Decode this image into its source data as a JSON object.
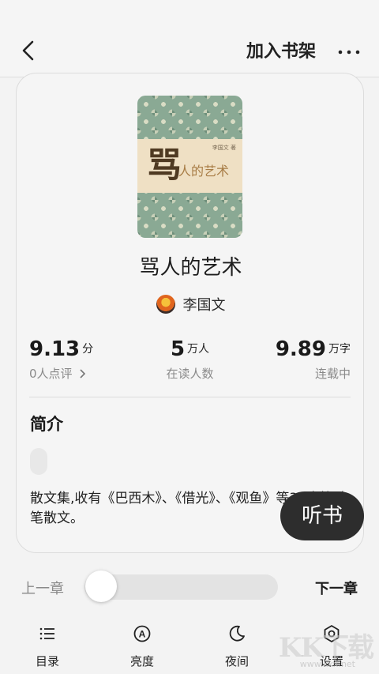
{
  "header": {
    "add_to_shelf": "加入书架"
  },
  "book": {
    "cover": {
      "author": "李国文 著",
      "big_char": "骂",
      "subtitle": "人的艺术"
    },
    "title": "骂人的艺术",
    "author": "李国文",
    "stats": [
      {
        "value": "9.13",
        "unit": "分",
        "label": "0人点评"
      },
      {
        "value": "5",
        "unit": "万人",
        "label": "在读人数"
      },
      {
        "value": "9.89",
        "unit": "万字",
        "label": "连载中"
      }
    ],
    "intro_heading": "简介",
    "intro_text": "散文集,收有《巴西木》、《借光》、《观鱼》等30余篇随笔散文。"
  },
  "listen_button": "听书",
  "chapter": {
    "prev": "上一章",
    "next": "下一章",
    "progress": 0
  },
  "bottom_nav": [
    {
      "label": "目录",
      "icon": "list-icon"
    },
    {
      "label": "亮度",
      "icon": "brightness-icon"
    },
    {
      "label": "夜间",
      "icon": "moon-icon"
    },
    {
      "label": "设置",
      "icon": "gear-icon"
    }
  ],
  "watermark": {
    "logo": "KK下载",
    "site": "www.kkx.net"
  },
  "colors": {
    "background": "#f3f3f3",
    "listen_button_bg": "#2d2d2d",
    "muted_text": "#8a8a8a"
  }
}
